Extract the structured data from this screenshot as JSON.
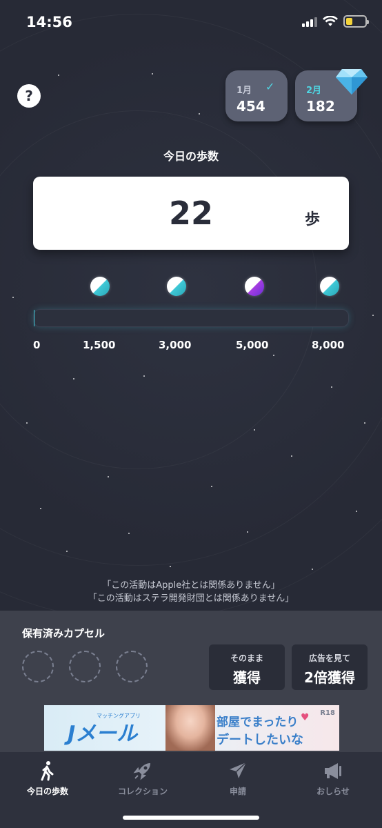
{
  "status_bar": {
    "time": "14:56"
  },
  "help": {
    "label": "?"
  },
  "months": [
    {
      "label": "1月",
      "value": "454",
      "checked": true
    },
    {
      "label": "2月",
      "value": "182",
      "checked": false
    }
  ],
  "steps": {
    "title": "今日の歩数",
    "value": "22",
    "unit": "歩"
  },
  "progress": {
    "current": 22,
    "max": 8000,
    "milestones": [
      {
        "label": "1,500",
        "value": 1500,
        "color": "teal"
      },
      {
        "label": "3,000",
        "value": 3000,
        "color": "teal"
      },
      {
        "label": "5,000",
        "value": 5000,
        "color": "purple"
      },
      {
        "label": "8,000",
        "value": 8000,
        "color": "teal"
      }
    ],
    "start_label": "0"
  },
  "disclaimers": [
    "「この活動はApple社とは関係ありません」",
    "「この活動はステラ開発財団とは関係ありません」"
  ],
  "capsules": {
    "title": "保有済みカプセル",
    "slots": 3,
    "buttons": [
      {
        "small": "そのまま",
        "big": "獲得"
      },
      {
        "small": "広告を見て",
        "big": "2倍獲得"
      }
    ]
  },
  "ad": {
    "logo": "Jメール",
    "logo_sub": "マッチングアプリ",
    "headline1": "部屋でまったり",
    "headline2": "デートしたいな",
    "badge": "R18"
  },
  "tabs": [
    {
      "label": "今日の歩数",
      "icon": "walking-icon",
      "active": true
    },
    {
      "label": "コレクション",
      "icon": "rocket-icon",
      "active": false
    },
    {
      "label": "申請",
      "icon": "paper-plane-icon",
      "active": false
    },
    {
      "label": "おしらせ",
      "icon": "megaphone-icon",
      "active": false
    }
  ],
  "colors": {
    "background": "#2a2d3a",
    "accent": "#43cfe0",
    "milestone_purple": "#a53de0",
    "card": "#5d6274",
    "panel": "#3e414c"
  }
}
